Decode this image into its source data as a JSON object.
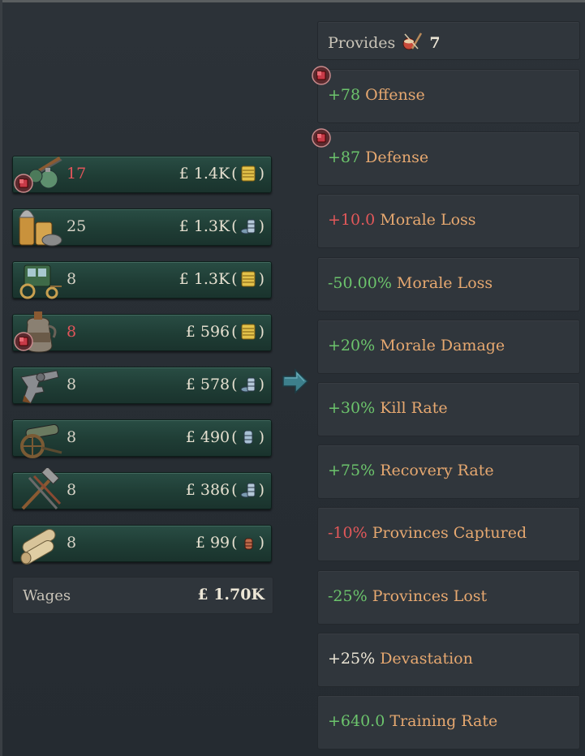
{
  "goods": [
    {
      "icon": "grenade-rifle-icon",
      "count": "17",
      "count_red": true,
      "price": "£ 1.4K",
      "coin": "gold-coin-icon",
      "warning": true
    },
    {
      "icon": "ammunition-icon",
      "count": "25",
      "count_red": false,
      "price": "£ 1.3K",
      "coin": "silver-coin-icon",
      "warning": false
    },
    {
      "icon": "carriage-icon",
      "count": "8",
      "count_red": false,
      "price": "£ 1.3K",
      "coin": "gold-coin-icon",
      "warning": false
    },
    {
      "icon": "liquor-jug-icon",
      "count": "8",
      "count_red": true,
      "price": "£ 596",
      "coin": "gold-coin-icon",
      "warning": true
    },
    {
      "icon": "revolver-icon",
      "count": "8",
      "count_red": false,
      "price": "£ 578",
      "coin": "silver-coin-icon",
      "warning": false
    },
    {
      "icon": "cannon-icon",
      "count": "8",
      "count_red": false,
      "price": "£ 490",
      "coin": "single-silver-coin-icon",
      "warning": false
    },
    {
      "icon": "tools-icon",
      "count": "8",
      "count_red": false,
      "price": "£ 386",
      "coin": "silver-coin-icon",
      "warning": false
    },
    {
      "icon": "fabric-rolls-icon",
      "count": "8",
      "count_red": false,
      "price": "£ 99",
      "coin": "copper-coin-icon",
      "warning": false
    }
  ],
  "wages": {
    "label": "Wages",
    "value": "£ 1.70K"
  },
  "provides": {
    "label": "Provides",
    "value": "7"
  },
  "modifiers": [
    {
      "value": "+78",
      "sign": "pos",
      "name": "Offense",
      "warning": true
    },
    {
      "value": "+87",
      "sign": "pos",
      "name": "Defense",
      "warning": true
    },
    {
      "value": "+10.0",
      "sign": "neg",
      "name": "Morale Loss",
      "warning": false
    },
    {
      "value": "-50.00%",
      "sign": "pos",
      "name": "Morale Loss",
      "warning": false
    },
    {
      "value": "+20%",
      "sign": "pos",
      "name": "Morale Damage",
      "warning": false
    },
    {
      "value": "+30%",
      "sign": "pos",
      "name": "Kill Rate",
      "warning": false
    },
    {
      "value": "+75%",
      "sign": "pos",
      "name": "Recovery Rate",
      "warning": false
    },
    {
      "value": "-10%",
      "sign": "neg",
      "name": "Provinces Captured",
      "warning": false
    },
    {
      "value": "-25%",
      "sign": "pos",
      "name": "Provinces Lost",
      "warning": false
    },
    {
      "value": "+25%",
      "sign": "wht",
      "name": "Devastation",
      "warning": false
    },
    {
      "value": "+640.0",
      "sign": "pos",
      "name": "Training Rate",
      "warning": false
    }
  ]
}
